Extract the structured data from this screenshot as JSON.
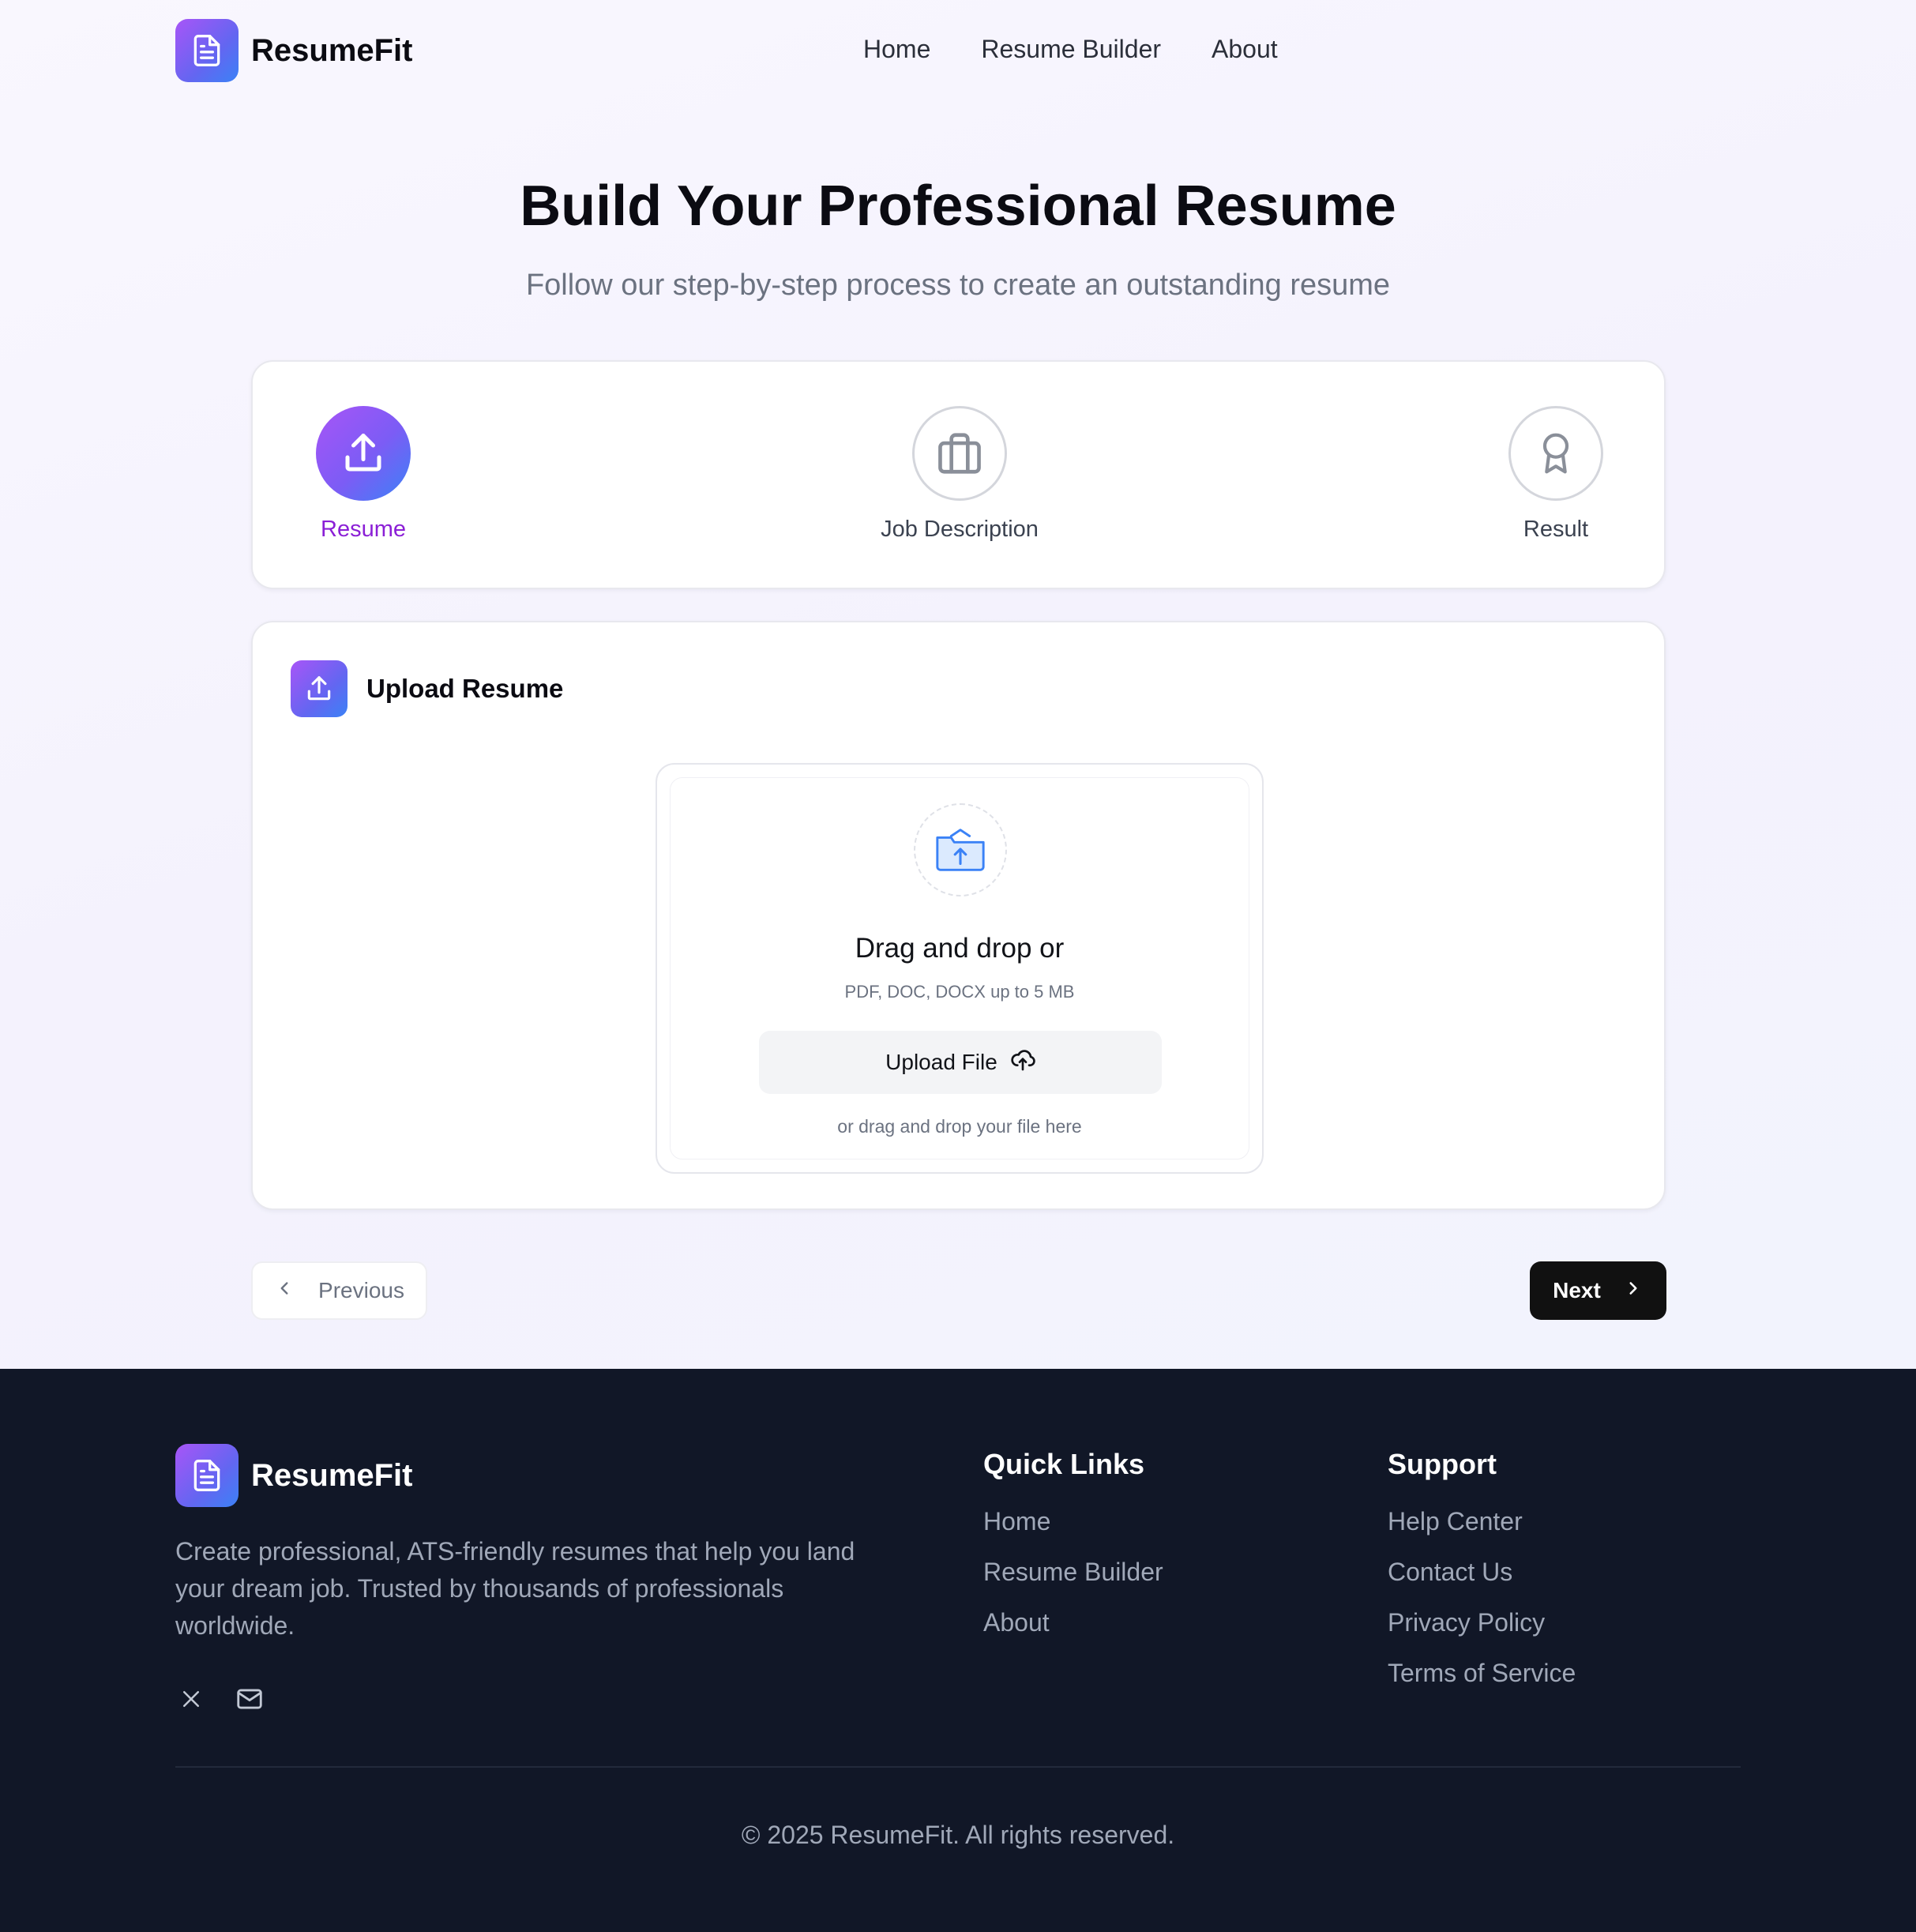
{
  "header": {
    "brand": "ResumeFit",
    "nav": [
      "Home",
      "Resume Builder",
      "About"
    ]
  },
  "hero": {
    "title": "Build Your Professional Resume",
    "subtitle": "Follow our step-by-step process to create an outstanding resume"
  },
  "steps": [
    {
      "label": "Resume",
      "icon": "upload-icon",
      "active": true
    },
    {
      "label": "Job Description",
      "icon": "briefcase-icon",
      "active": false
    },
    {
      "label": "Result",
      "icon": "award-icon",
      "active": false
    }
  ],
  "upload": {
    "title": "Upload Resume",
    "drop_title": "Drag and drop or",
    "hint": "PDF, DOC, DOCX up to 5 MB",
    "button": "Upload File",
    "foot": "or drag and drop your file here"
  },
  "navigation": {
    "previous": "Previous",
    "next": "Next"
  },
  "footer": {
    "brand": "ResumeFit",
    "description": "Create professional, ATS-friendly resumes that help you land your dream job. Trusted by thousands of professionals worldwide.",
    "social": [
      "x-icon",
      "mail-icon"
    ],
    "quick_links": {
      "title": "Quick Links",
      "items": [
        "Home",
        "Resume Builder",
        "About"
      ]
    },
    "support": {
      "title": "Support",
      "items": [
        "Help Center",
        "Contact Us",
        "Privacy Policy",
        "Terms of Service"
      ]
    },
    "copyright": "© 2025 ResumeFit. All rights reserved."
  },
  "colors": {
    "accent_purple": "#a855f7",
    "accent_blue": "#3b82f6",
    "active_step_label": "#8b1fd6",
    "footer_bg": "#111727"
  }
}
